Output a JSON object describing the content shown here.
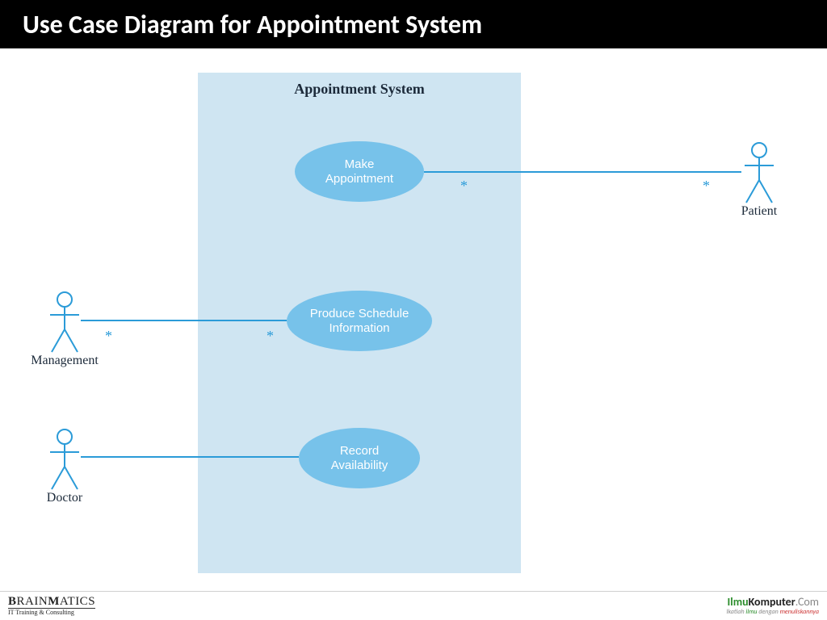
{
  "title": "Use Case Diagram for Appointment System",
  "system": {
    "name": "Appointment System"
  },
  "usecases": {
    "make_appointment": "Make\nAppointment",
    "produce_schedule": "Produce Schedule\nInformation",
    "record_availability": "Record\nAvailability"
  },
  "actors": {
    "patient": "Patient",
    "management": "Management",
    "doctor": "Doctor"
  },
  "multiplicity": {
    "star": "*"
  },
  "footer": {
    "left_brand": "BRAINMATICS",
    "left_tagline": "IT Training & Consulting",
    "right_brand_1": "Ilmu",
    "right_brand_2": "Komputer",
    "right_brand_3": ".Com",
    "right_tag_a": "Ikatlah ",
    "right_tag_b": "ilmu",
    "right_tag_c": " dengan ",
    "right_tag_d": "menuliskannya"
  }
}
